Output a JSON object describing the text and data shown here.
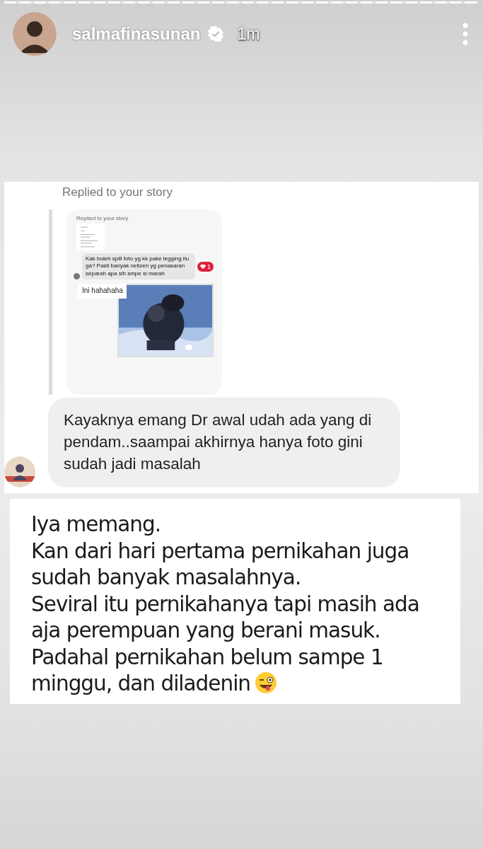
{
  "header": {
    "progress": {
      "level": 1
    },
    "username": "salmafinasunan",
    "verified": true,
    "time": "1m"
  },
  "reply": {
    "label": "Replied to your story",
    "story_preview": {
      "label": "Replied to your story",
      "comment": "Kak boleh spill foto yg kk pake legging itu ga? Pasti banyak netizen yg penasaran separah apa sih smpe si marah",
      "likes": "1",
      "caption": "Ini hahahaha"
    },
    "message": "Kayaknya emang Dr awal udah ada yang di pendam..saampai akhirnya hanya foto gini sudah jadi masalah"
  },
  "story_text": "Iya memang.\nKan dari hari pertama pernikahan juga sudah banyak masalahnya.\nSeviral itu pernikahanya tapi masih ada aja perempuan yang berani masuk.\nPadahal pernikahan belum sampe 1 minggu, dan diladenin"
}
